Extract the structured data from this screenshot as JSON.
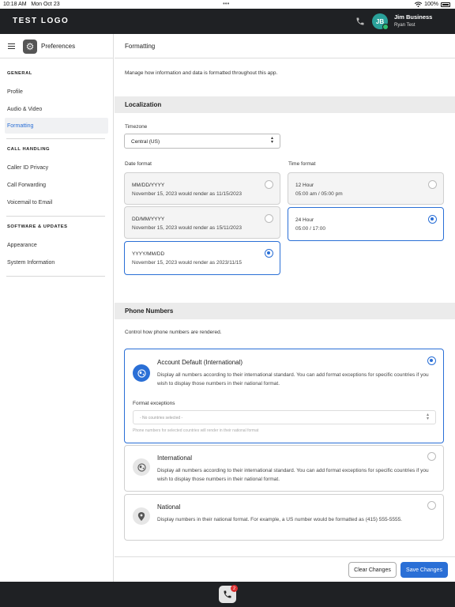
{
  "status_bar": {
    "time": "10:18 AM",
    "date": "Mon Oct 23",
    "battery": "100%"
  },
  "app": {
    "logo": "TEST LOGO"
  },
  "user": {
    "initials": "JB",
    "name": "Jim Business",
    "sub": "Ryan Test"
  },
  "sidebar": {
    "title": "Preferences",
    "sections": [
      {
        "label": "GENERAL",
        "items": [
          "Profile",
          "Audio & Video",
          "Formatting"
        ]
      },
      {
        "label": "CALL HANDLING",
        "items": [
          "Caller ID Privacy",
          "Call Forwarding",
          "Voicemail to Email"
        ]
      },
      {
        "label": "SOFTWARE & UPDATES",
        "items": [
          "Appearance",
          "System Information"
        ]
      }
    ],
    "active_item": "Formatting"
  },
  "main": {
    "title": "Formatting",
    "intro": "Manage how information and data is formatted throughout this app.",
    "localization": {
      "heading": "Localization",
      "timezone_label": "Timezone",
      "timezone_value": "Central (US)",
      "date_format_label": "Date format",
      "date_formats": [
        {
          "title": "MM/DD/YYYY",
          "example": "November 15, 2023 would render as 11/15/2023",
          "selected": false
        },
        {
          "title": "DD/MM/YYYY",
          "example": "November 15, 2023 would render as 15/11/2023",
          "selected": false
        },
        {
          "title": "YYYY/MM/DD",
          "example": "November 15, 2023 would render as 2023/11/15",
          "selected": true
        }
      ],
      "time_format_label": "Time format",
      "time_formats": [
        {
          "title": "12 Hour",
          "example": "05:00 am / 05:00 pm",
          "selected": false
        },
        {
          "title": "24 Hour",
          "example": "05:00 / 17:00",
          "selected": true
        }
      ]
    },
    "phone_numbers": {
      "heading": "Phone Numbers",
      "intro": "Control how phone numbers are rendered.",
      "options": [
        {
          "title": "Account Default (International)",
          "description": "Display all numbers according to their international standard. You can add format exceptions for specific countries if you wish to display those numbers in their national format.",
          "selected": true,
          "exceptions_label": "Format exceptions",
          "exceptions_placeholder": "- No countries selected -",
          "exceptions_help": "Phone numbers for selected countries will render in their national format"
        },
        {
          "title": "International",
          "description": "Display all numbers according to their international standard. You can add format exceptions for specific countries if you wish to display those numbers in their national format.",
          "selected": false
        },
        {
          "title": "National",
          "description": "Display numbers in their national format. For example, a US number would be formatted as (415) 555-5555.",
          "selected": false
        }
      ]
    },
    "footer": {
      "clear_label": "Clear Changes",
      "save_label": "Save Changes"
    }
  },
  "dock": {
    "badge_count": "2"
  },
  "colors": {
    "accent": "#2a6fd6",
    "topbar": "#1f2124",
    "band": "#ebebeb",
    "avatar": "#2aa19a",
    "online": "#2fbf71",
    "badge": "#d93030"
  }
}
